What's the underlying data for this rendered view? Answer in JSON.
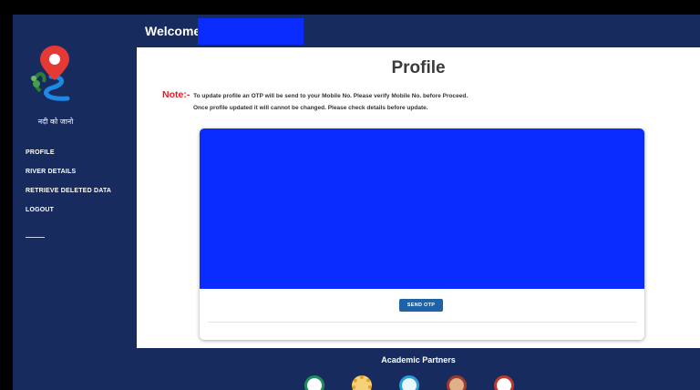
{
  "brand": {
    "tagline": "नदी को जानो",
    "accent": "#172b5e"
  },
  "header": {
    "welcome": "Welcome"
  },
  "sidebar": {
    "items": [
      {
        "label": "PROFILE"
      },
      {
        "label": "RIVER DETAILS"
      },
      {
        "label": "RETRIEVE DELETED DATA"
      },
      {
        "label": "LOGOUT"
      }
    ]
  },
  "main": {
    "title": "Profile",
    "note_label": "Note:-",
    "note_line1": "To update profile an OTP will be send to your Mobile No. Please verify Mobile No. before Proceed.",
    "note_line2": "Once profile updated it will cannot be changed. Please check details before update.",
    "send_otp": "SEND OTP"
  },
  "footer": {
    "title": "Academic Partners",
    "partners": [
      {
        "icon": "partner-logo-1-icon",
        "color": "#1f8f5a"
      },
      {
        "icon": "partner-logo-2-icon",
        "color": "#e8a317"
      },
      {
        "icon": "partner-logo-3-icon",
        "color": "#2a9fd6"
      },
      {
        "icon": "partner-logo-4-icon",
        "color": "#9c3b2c"
      },
      {
        "icon": "partner-logo-5-icon",
        "color": "#c0392b"
      }
    ]
  }
}
